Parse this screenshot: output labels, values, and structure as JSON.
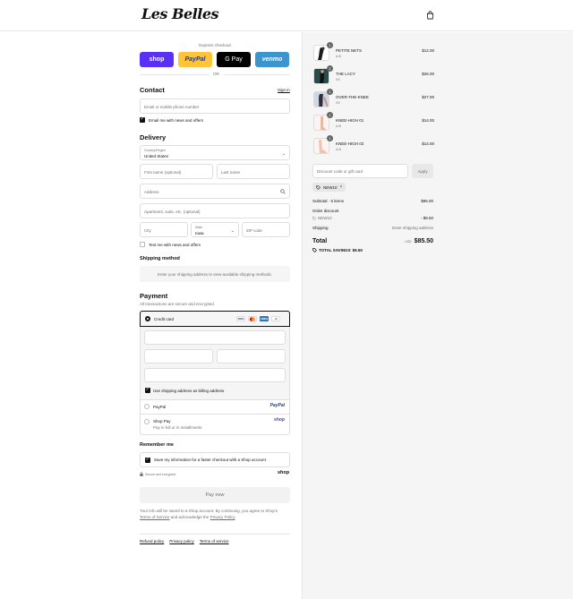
{
  "brand": {
    "logo_text": "Les Belles"
  },
  "express": {
    "title": "Express checkout",
    "buttons": [
      {
        "label": "shop",
        "bg": "#5a31f4",
        "fg": "#ffffff"
      },
      {
        "label": "PayPal",
        "bg": "#ffc439",
        "fg": "#253b80"
      },
      {
        "label": "G Pay",
        "bg": "#000000",
        "fg": "#ffffff"
      },
      {
        "label": "venmo",
        "bg": "#3d95ce",
        "fg": "#ffffff"
      }
    ],
    "or": "OR"
  },
  "contact": {
    "heading": "Contact",
    "sign_in": "Sign in",
    "email_placeholder": "Email or mobile phone number",
    "news_label": "Email me with news and offers"
  },
  "delivery": {
    "heading": "Delivery",
    "country_label": "Country/Region",
    "country_value": "United States",
    "first_name": "First name (optional)",
    "last_name": "Last name",
    "address": "Address",
    "apartment": "Apartment, suite, etc. (optional)",
    "city": "City",
    "state_label": "State",
    "state_value": "Iowa",
    "zip": "ZIP code",
    "text_label": "Text me with news and offers"
  },
  "shipping": {
    "heading": "Shipping method",
    "message": "Enter your shipping address to view available shipping methods."
  },
  "payment": {
    "heading": "Payment",
    "subtitle": "All transactions are secure and encrypted.",
    "credit_card": "Credit card",
    "card_brands": [
      "VISA",
      "MC",
      "AMEX"
    ],
    "more_brands": "+5",
    "billing_label": "Use shipping address as billing address",
    "paypal": "PayPal",
    "paypal_logo": "PayPal",
    "shop_pay": "Shop Pay",
    "shop_pay_sub": "Pay in full or in installments",
    "shop_pay_logo": "shop"
  },
  "remember": {
    "heading": "Remember me",
    "save_label": "Save my information for a faster checkout with a Shop account",
    "secure": "Secure and encrypted",
    "shop_logo": "shop"
  },
  "pay_button": "Pay now",
  "legal": {
    "line1": "Your info will be saved to a Shop account. By continuing, you agree to Shop's",
    "terms": "Terms of Service",
    "and": "and acknowledge the",
    "privacy": "Privacy Policy",
    "footer_links": [
      "Refund policy",
      "Privacy policy",
      "Terms of service"
    ]
  },
  "cart": {
    "items": [
      {
        "name": "PETITE NETS",
        "size": "A-B",
        "price": "$12.00",
        "qty": "1"
      },
      {
        "name": "THE LACY",
        "size": "XS",
        "price": "$26.00",
        "qty": "1"
      },
      {
        "name": "OVER-THE-KNEE",
        "size": "XS",
        "price": "$27.00",
        "qty": "1"
      },
      {
        "name": "KNEE-HIGH 01",
        "size": "A-B",
        "price": "$14.00",
        "qty": "1"
      },
      {
        "name": "KNEE-HIGH 02",
        "size": "A-B",
        "price": "$14.00",
        "qty": "1"
      }
    ],
    "discount_placeholder": "Discount code or gift card",
    "apply": "Apply",
    "code_tag": "NEW10",
    "subtotal_label": "Subtotal · 5 items",
    "subtotal_value": "$95.00",
    "order_discount": "Order discount",
    "discount_code": "NEW10",
    "discount_value": "- $9.50",
    "shipping_label": "Shipping",
    "shipping_value": "Enter shipping address",
    "total_label": "Total",
    "currency": "USD",
    "total_value": "$85.50",
    "savings_label": "TOTAL SAVINGS",
    "savings_value": "$9.50"
  }
}
